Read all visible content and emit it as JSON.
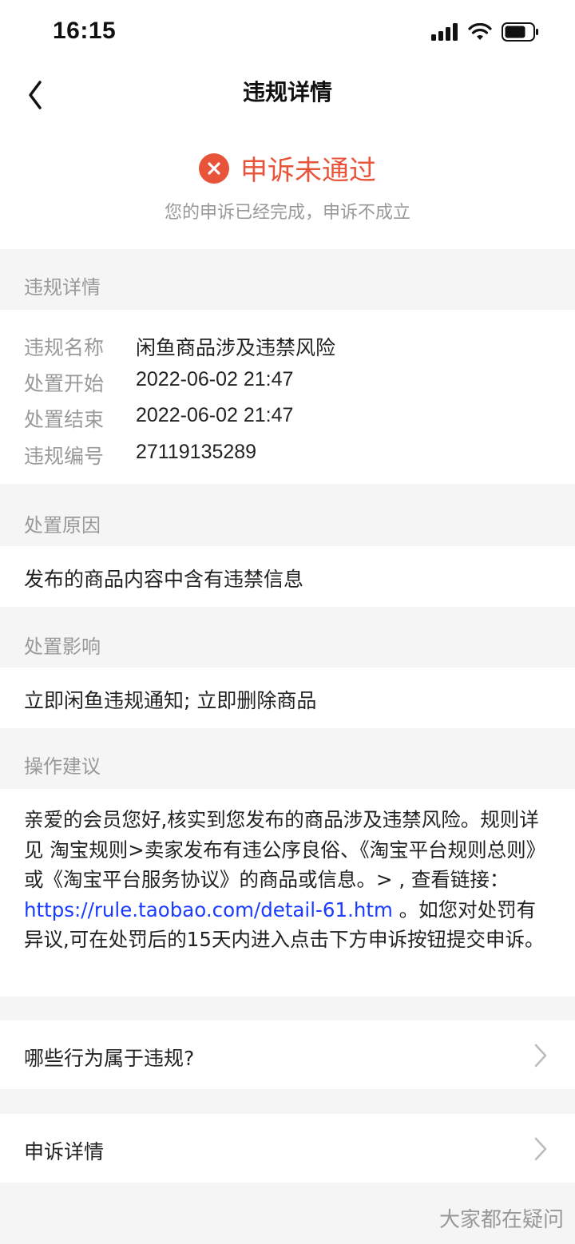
{
  "status_bar": {
    "time": "16:15"
  },
  "nav": {
    "title": "违规详情"
  },
  "result": {
    "title": "申诉未通过",
    "subtitle": "您的申诉已经完成，申诉不成立"
  },
  "details": {
    "section_title": "违规详情",
    "rows": [
      {
        "key": "违规名称",
        "value": "闲鱼商品涉及违禁风险"
      },
      {
        "key": "处置开始",
        "value": "2022-06-02 21:47"
      },
      {
        "key": "处置结束",
        "value": "2022-06-02 21:47"
      },
      {
        "key": "违规编号",
        "value": "27119135289"
      }
    ]
  },
  "reason": {
    "section_title": "处置原因",
    "text": "发布的商品内容中含有违禁信息"
  },
  "impact": {
    "section_title": "处置影响",
    "text": "立即闲鱼违规通知; 立即删除商品"
  },
  "advice": {
    "section_title": "操作建议",
    "text_before_link": "亲爱的会员您好,核实到您发布的商品涉及违禁风险。规则详见 淘宝规则>卖家发布有违公序良俗、《淘宝平台规则总则》或《淘宝平台服务协议》的商品或信息。> , 查看链接： ",
    "link": "https://rule.taobao.com/detail-61.htm",
    "text_after_link": " 。如您对处罚有异议,可在处罚后的15天内进入点击下方申诉按钮提交申诉。"
  },
  "entries": [
    {
      "label": "哪些行为属于违规?"
    },
    {
      "label": "申诉详情"
    }
  ],
  "watermark": "大家都在疑问",
  "colors": {
    "accent_red": "#e8543a",
    "link_blue": "#1a3cff",
    "muted": "#999999"
  }
}
